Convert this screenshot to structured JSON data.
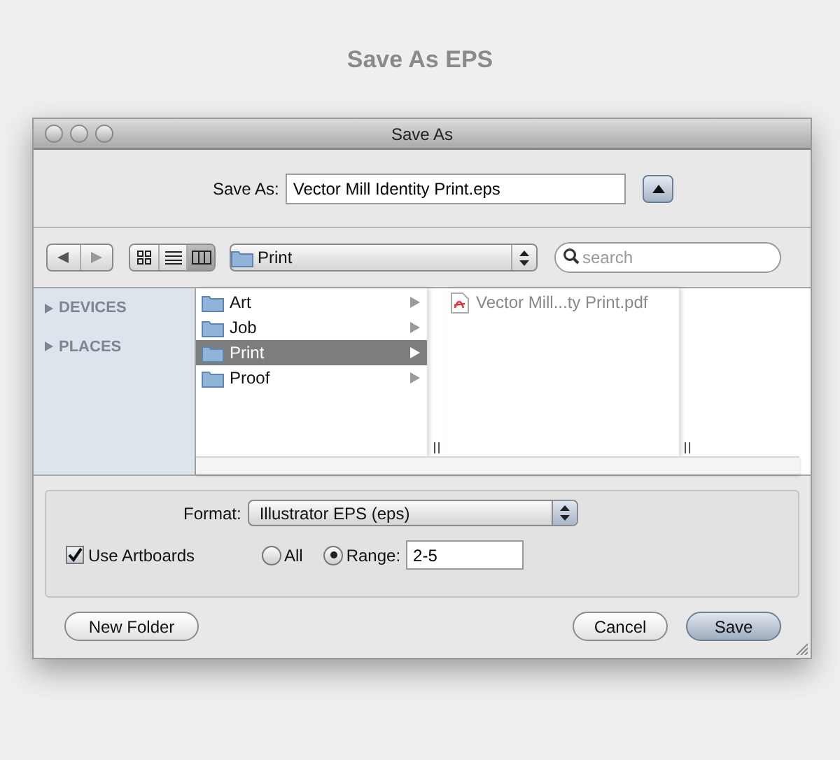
{
  "heading": "Save As EPS",
  "window": {
    "title": "Save As"
  },
  "save_as": {
    "label": "Save As:",
    "value": "Vector Mill Identity Print.eps"
  },
  "toolbar": {
    "view_modes": [
      {
        "kind": "icons",
        "selected": false
      },
      {
        "kind": "list",
        "selected": false
      },
      {
        "kind": "columns",
        "selected": true
      }
    ],
    "path": "Print",
    "search_placeholder": "search"
  },
  "sidebar": [
    {
      "label": "DEVICES"
    },
    {
      "label": "PLACES"
    }
  ],
  "folders": [
    {
      "name": "Art",
      "selected": false
    },
    {
      "name": "Job",
      "selected": false
    },
    {
      "name": "Print",
      "selected": true
    },
    {
      "name": "Proof",
      "selected": false
    }
  ],
  "files": [
    {
      "name": "Vector Mill...ty Print.pdf"
    }
  ],
  "options": {
    "format_label": "Format:",
    "format": "Illustrator EPS (eps)",
    "use_artboards": {
      "label": "Use Artboards",
      "checked": true
    },
    "radios": [
      {
        "label": "All",
        "selected": false
      },
      {
        "label": "Range:",
        "selected": true
      }
    ],
    "range": "2-5"
  },
  "buttons": [
    {
      "label": "New Folder",
      "default": false
    },
    {
      "label": "Cancel",
      "default": false
    },
    {
      "label": "Save",
      "default": true
    }
  ]
}
